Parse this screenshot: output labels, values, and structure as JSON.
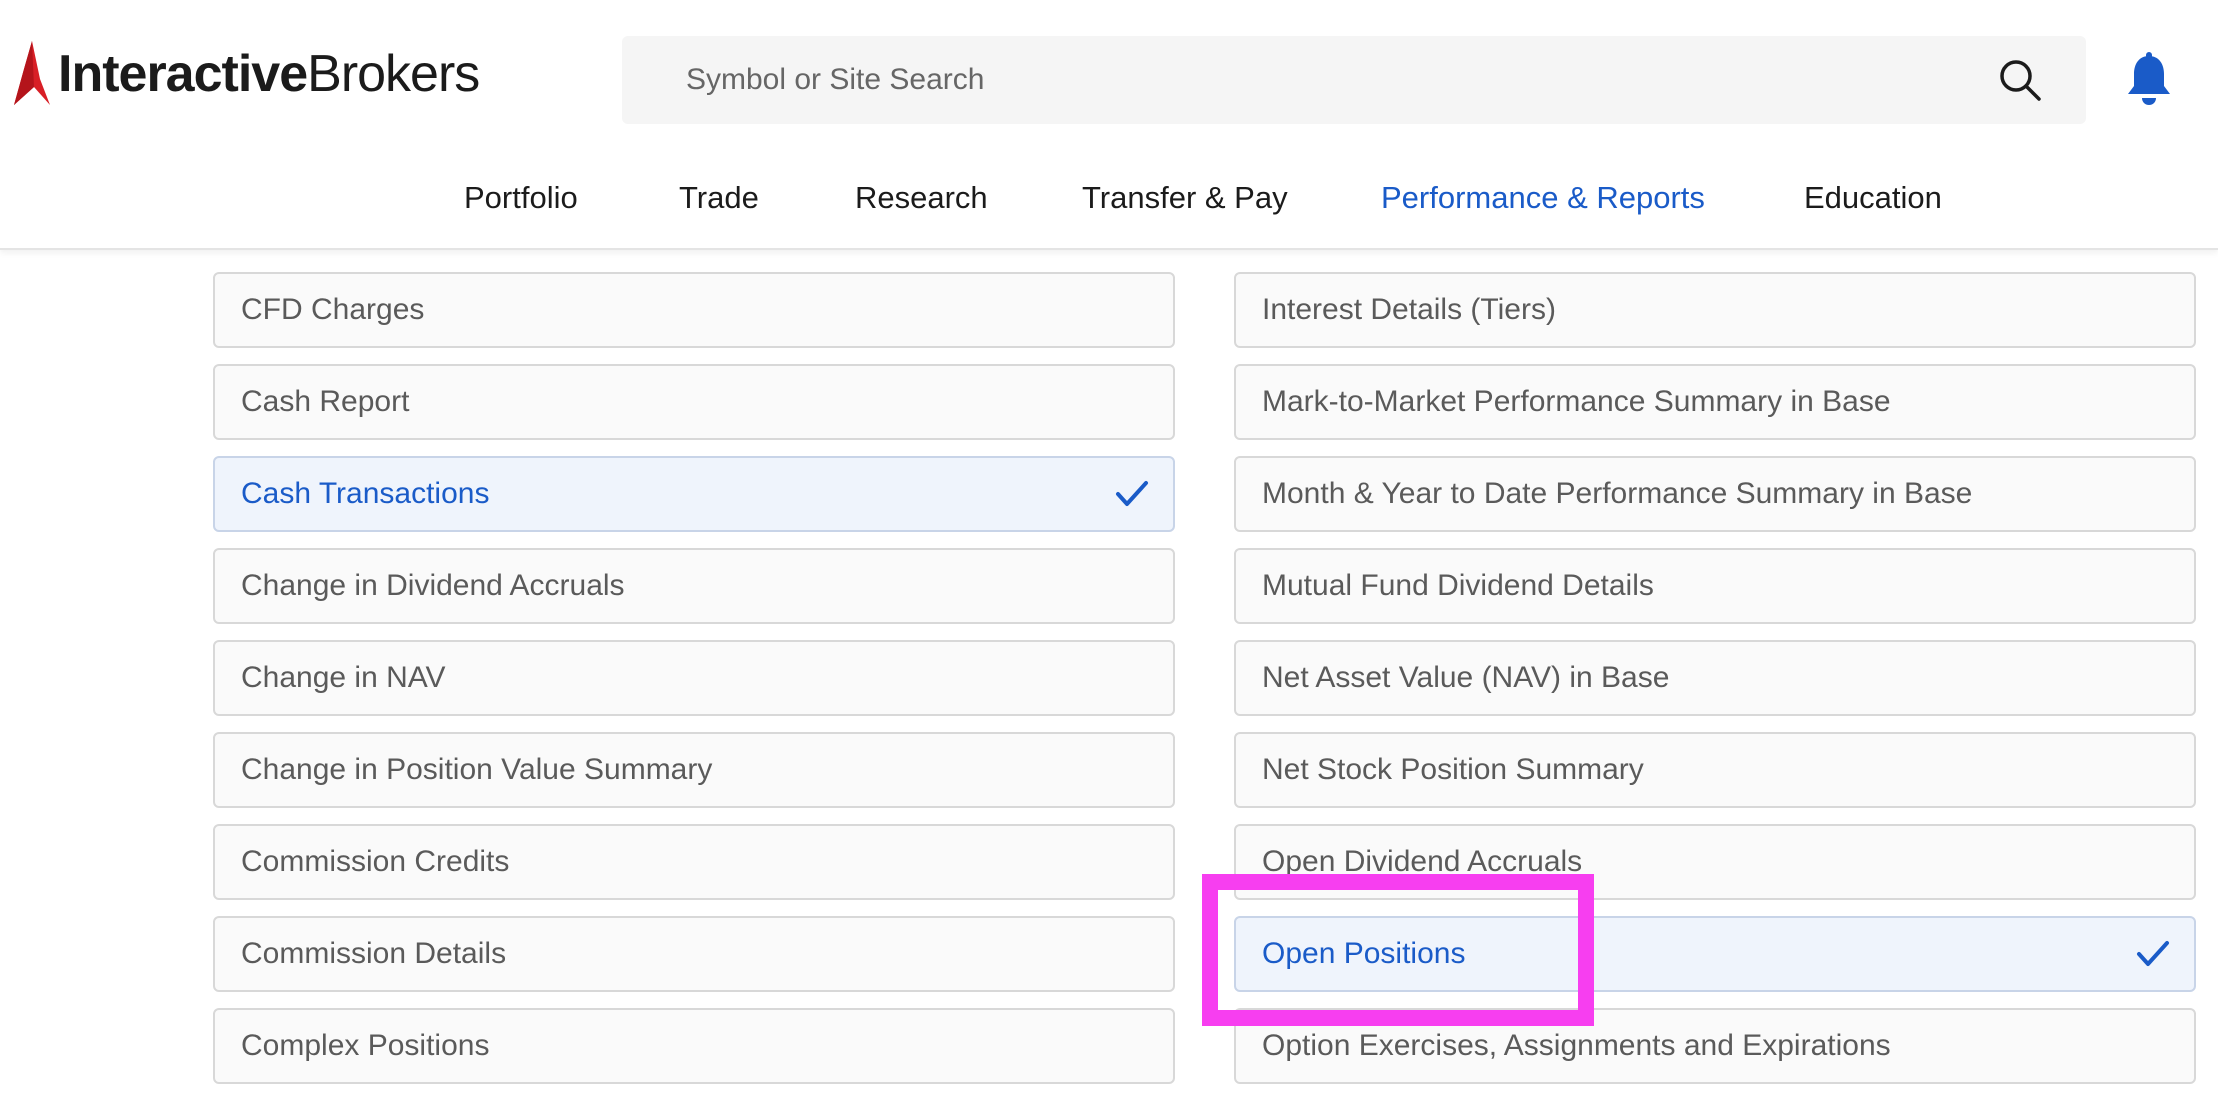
{
  "brand": {
    "name_bold": "Interactive",
    "name_regular": "Brokers",
    "accent_color": "#d81f26"
  },
  "search": {
    "placeholder": "Symbol or Site Search",
    "icon": "search-icon"
  },
  "notifications": {
    "icon": "bell-icon",
    "color": "#1a5bc8"
  },
  "nav": {
    "items": [
      {
        "label": "Portfolio"
      },
      {
        "label": "Trade"
      },
      {
        "label": "Research"
      },
      {
        "label": "Transfer & Pay"
      },
      {
        "label": "Performance & Reports",
        "active": true
      },
      {
        "label": "Education"
      }
    ],
    "active_color": "#1a5bc8"
  },
  "sections": {
    "left": [
      {
        "label": "CFD Charges"
      },
      {
        "label": "Cash Report"
      },
      {
        "label": "Cash Transactions",
        "selected": true
      },
      {
        "label": "Change in Dividend Accruals"
      },
      {
        "label": "Change in NAV"
      },
      {
        "label": "Change in Position Value Summary"
      },
      {
        "label": "Commission Credits"
      },
      {
        "label": "Commission Details"
      },
      {
        "label": "Complex Positions"
      }
    ],
    "right": [
      {
        "label": "Interest Details (Tiers)"
      },
      {
        "label": "Mark-to-Market Performance Summary in Base"
      },
      {
        "label": "Month & Year to Date Performance Summary in Base"
      },
      {
        "label": "Mutual Fund Dividend Details"
      },
      {
        "label": "Net Asset Value (NAV) in Base"
      },
      {
        "label": "Net Stock Position Summary"
      },
      {
        "label": "Open Dividend Accruals"
      },
      {
        "label": "Open Positions",
        "selected": true
      },
      {
        "label": "Option Exercises, Assignments and Expirations"
      }
    ]
  },
  "highlight_color": "#f73ef0"
}
